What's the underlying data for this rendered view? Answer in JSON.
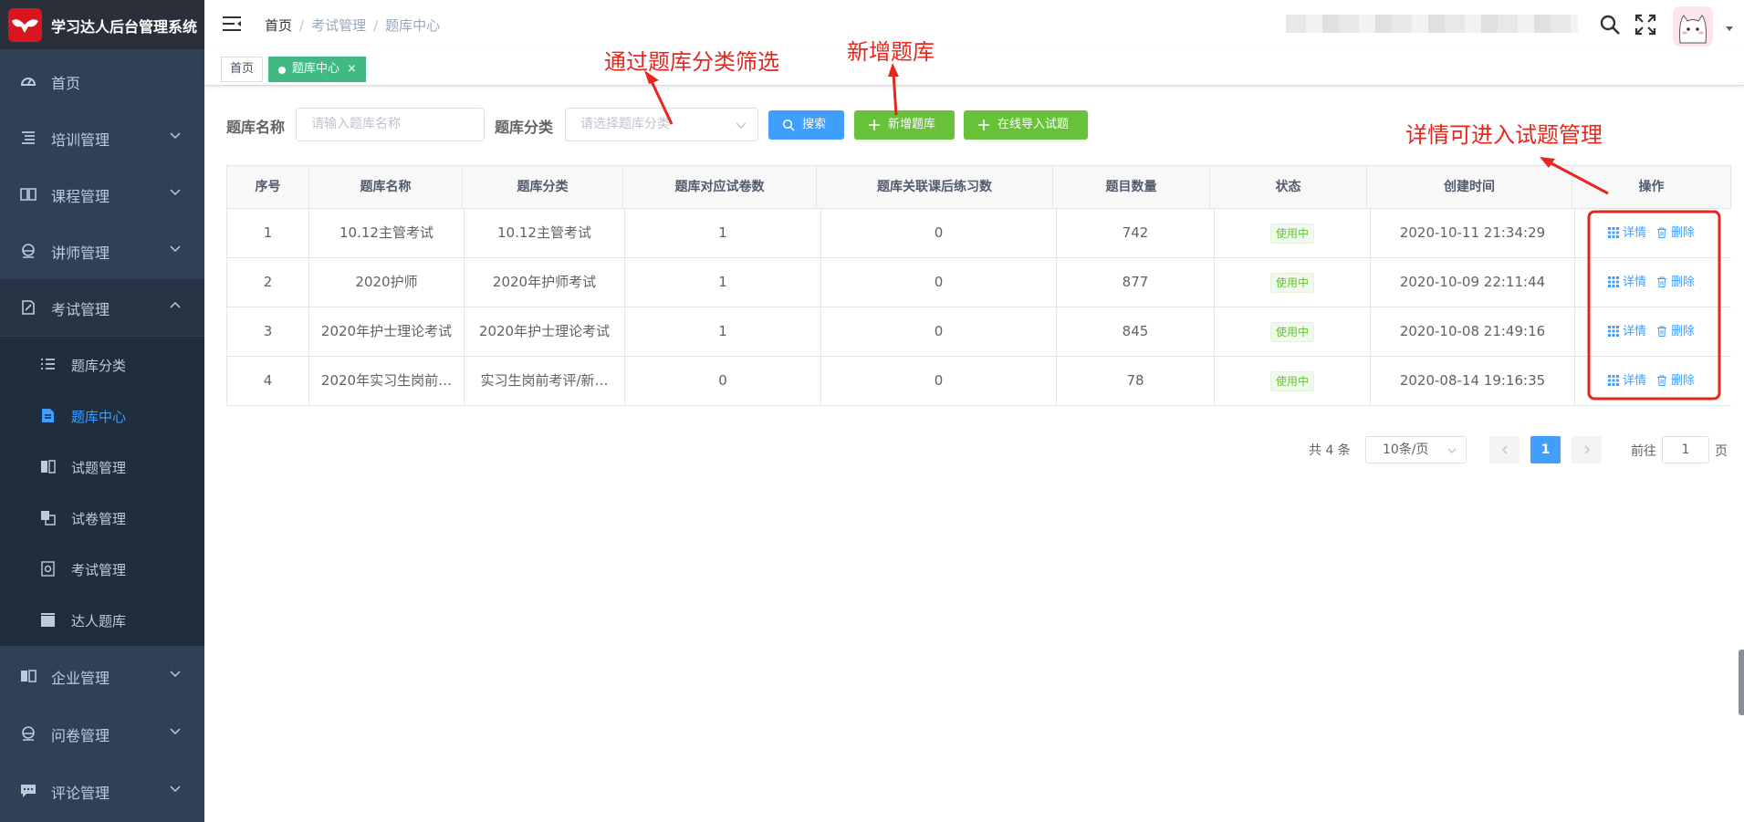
{
  "app": {
    "title": "学习达人后台管理系统"
  },
  "sidebar": {
    "items": [
      {
        "label": "首页",
        "icon": "dashboard-icon"
      },
      {
        "label": "培训管理",
        "icon": "list-icon"
      },
      {
        "label": "课程管理",
        "icon": "book-icon"
      },
      {
        "label": "讲师管理",
        "icon": "teacher-icon"
      },
      {
        "label": "考试管理",
        "icon": "exam-icon",
        "expanded": true
      },
      {
        "label": "企业管理",
        "icon": "company-icon"
      },
      {
        "label": "问卷管理",
        "icon": "survey-icon"
      },
      {
        "label": "评论管理",
        "icon": "comment-icon"
      }
    ],
    "subitems": [
      {
        "label": "题库分类",
        "icon": "list-icon"
      },
      {
        "label": "题库中心",
        "icon": "document-icon",
        "active": true
      },
      {
        "label": "试题管理",
        "icon": "book-open-icon"
      },
      {
        "label": "试卷管理",
        "icon": "copy-icon"
      },
      {
        "label": "考试管理",
        "icon": "safe-icon"
      },
      {
        "label": "达人题库",
        "icon": "clapper-icon"
      }
    ]
  },
  "header": {
    "breadcrumb": [
      "首页",
      "考试管理",
      "题库中心"
    ]
  },
  "tags": {
    "home": "首页",
    "active": "题库中心",
    "close": "×"
  },
  "filters": {
    "name_label": "题库名称",
    "name_placeholder": "请输入题库名称",
    "category_label": "题库分类",
    "category_placeholder": "请选择题库分类",
    "search_label": "搜索",
    "add_label": "新增题库",
    "import_label": "在线导入试题"
  },
  "table": {
    "columns": [
      "序号",
      "题库名称",
      "题库分类",
      "题库对应试卷数",
      "题库关联课后练习数",
      "题目数量",
      "状态",
      "创建时间",
      "操作"
    ],
    "rows": [
      {
        "index": "1",
        "name": "10.12主管考试",
        "category": "10.12主管考试",
        "papers": "1",
        "exercises": "0",
        "questions": "742",
        "status": "使用中",
        "created": "2020-10-11 21:34:29"
      },
      {
        "index": "2",
        "name": "2020护师",
        "category": "2020年护师考试",
        "papers": "1",
        "exercises": "0",
        "questions": "877",
        "status": "使用中",
        "created": "2020-10-09 22:11:44"
      },
      {
        "index": "3",
        "name": "2020年护士理论考试",
        "category": "2020年护士理论考试",
        "papers": "1",
        "exercises": "0",
        "questions": "845",
        "status": "使用中",
        "created": "2020-10-08 21:49:16"
      },
      {
        "index": "4",
        "name": "2020年实习生岗前…",
        "category": "实习生岗前考评/新…",
        "papers": "0",
        "exercises": "0",
        "questions": "78",
        "status": "使用中",
        "created": "2020-08-14 19:16:35"
      }
    ],
    "detail_label": "详情",
    "delete_label": "删除"
  },
  "pagination": {
    "total": "共 4 条",
    "page_size": "10条/页",
    "current_page": "1",
    "goto_label": "前往",
    "goto_value": "1",
    "goto_suffix": "页"
  },
  "annotations": {
    "filter_note": "通过题库分类筛选",
    "add_note": "新增题库",
    "detail_note": "详情可进入试题管理"
  },
  "colors": {
    "sidebar": "#304156",
    "primary": "#409eff",
    "success": "#67c23a",
    "tag_active": "#42b983",
    "annotation": "#e8261b"
  }
}
